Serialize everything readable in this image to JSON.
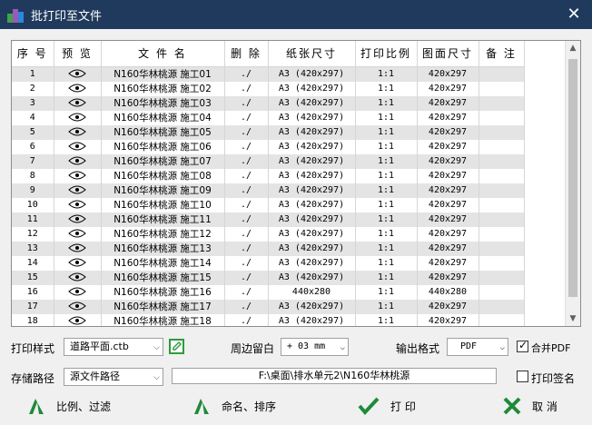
{
  "window": {
    "title": "批打印至文件",
    "close_icon": "close-icon"
  },
  "table": {
    "columns": [
      "序 号",
      "预 览",
      "文 件 名",
      "删 除",
      "纸张尺寸",
      "打印比例",
      "图面尺寸",
      "备 注"
    ],
    "rows": [
      {
        "no": "1",
        "name": "N160华林桃源 施工01",
        "del": "./",
        "paper": "A3 (420x297)",
        "scale": "1:1",
        "size": "420x297"
      },
      {
        "no": "2",
        "name": "N160华林桃源 施工02",
        "del": "./",
        "paper": "A3 (420x297)",
        "scale": "1:1",
        "size": "420x297"
      },
      {
        "no": "3",
        "name": "N160华林桃源 施工03",
        "del": "./",
        "paper": "A3 (420x297)",
        "scale": "1:1",
        "size": "420x297"
      },
      {
        "no": "4",
        "name": "N160华林桃源 施工04",
        "del": "./",
        "paper": "A3 (420x297)",
        "scale": "1:1",
        "size": "420x297"
      },
      {
        "no": "5",
        "name": "N160华林桃源 施工05",
        "del": "./",
        "paper": "A3 (420x297)",
        "scale": "1:1",
        "size": "420x297"
      },
      {
        "no": "6",
        "name": "N160华林桃源 施工06",
        "del": "./",
        "paper": "A3 (420x297)",
        "scale": "1:1",
        "size": "420x297"
      },
      {
        "no": "7",
        "name": "N160华林桃源 施工07",
        "del": "./",
        "paper": "A3 (420x297)",
        "scale": "1:1",
        "size": "420x297"
      },
      {
        "no": "8",
        "name": "N160华林桃源 施工08",
        "del": "./",
        "paper": "A3 (420x297)",
        "scale": "1:1",
        "size": "420x297"
      },
      {
        "no": "9",
        "name": "N160华林桃源 施工09",
        "del": "./",
        "paper": "A3 (420x297)",
        "scale": "1:1",
        "size": "420x297"
      },
      {
        "no": "10",
        "name": "N160华林桃源 施工10",
        "del": "./",
        "paper": "A3 (420x297)",
        "scale": "1:1",
        "size": "420x297"
      },
      {
        "no": "11",
        "name": "N160华林桃源 施工11",
        "del": "./",
        "paper": "A3 (420x297)",
        "scale": "1:1",
        "size": "420x297"
      },
      {
        "no": "12",
        "name": "N160华林桃源 施工12",
        "del": "./",
        "paper": "A3 (420x297)",
        "scale": "1:1",
        "size": "420x297"
      },
      {
        "no": "13",
        "name": "N160华林桃源 施工13",
        "del": "./",
        "paper": "A3 (420x297)",
        "scale": "1:1",
        "size": "420x297"
      },
      {
        "no": "14",
        "name": "N160华林桃源 施工14",
        "del": "./",
        "paper": "A3 (420x297)",
        "scale": "1:1",
        "size": "420x297"
      },
      {
        "no": "15",
        "name": "N160华林桃源 施工15",
        "del": "./",
        "paper": "A3 (420x297)",
        "scale": "1:1",
        "size": "420x297"
      },
      {
        "no": "16",
        "name": "N160华林桃源 施工16",
        "del": "./",
        "paper": "440x280",
        "scale": "1:1",
        "size": "440x280"
      },
      {
        "no": "17",
        "name": "N160华林桃源 施工17",
        "del": "./",
        "paper": "A3 (420x297)",
        "scale": "1:1",
        "size": "420x297"
      },
      {
        "no": "18",
        "name": "N160华林桃源 施工18",
        "del": "./",
        "paper": "A3 (420x297)",
        "scale": "1:1",
        "size": "420x297"
      }
    ]
  },
  "options": {
    "print_style_label": "打印样式",
    "print_style_value": "道路平面.ctb",
    "margin_label": "周边留白",
    "margin_value": "+ 03 mm",
    "output_format_label": "输出格式",
    "output_format_value": "PDF",
    "merge_pdf_label": "合并PDF",
    "merge_pdf_checked": true,
    "storage_path_label": "存储路径",
    "storage_path_value": "源文件路径",
    "path_text": "F:\\桌面\\排水单元2\\N160华林桃源",
    "print_sign_label": "打印签名",
    "print_sign_checked": false
  },
  "buttons": {
    "scale_filter": "比例、过滤",
    "name_sort": "命名、排序",
    "print": "打 印",
    "cancel": "取 消"
  },
  "colors": {
    "titlebar": "#1f3a5c",
    "green": "#1e8a3a",
    "row_alt": "#e4e4e4"
  }
}
